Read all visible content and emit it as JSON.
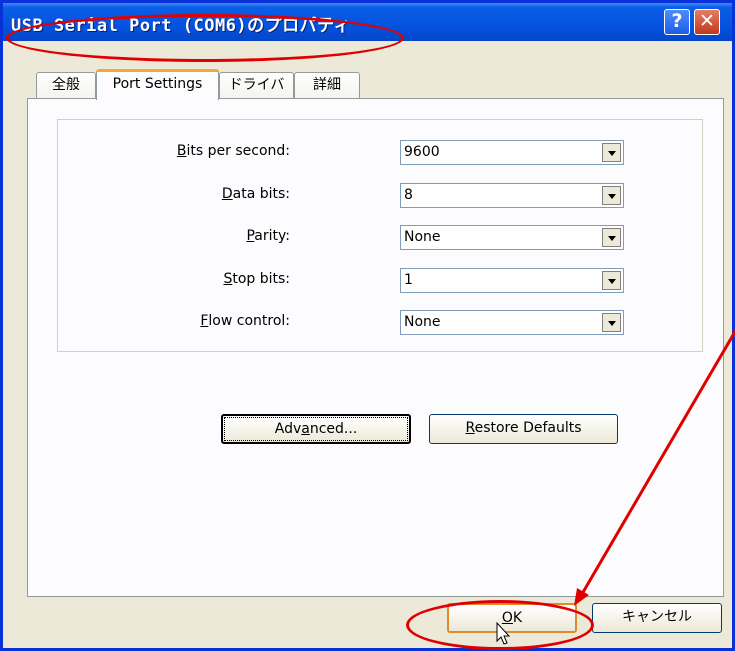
{
  "window": {
    "title": "USB Serial Port (COM6)のプロパティ",
    "help_glyph": "?",
    "close_glyph": "✕"
  },
  "tabs": [
    {
      "label": "全般",
      "active": false
    },
    {
      "label": "Port Settings",
      "active": true
    },
    {
      "label": "ドライバ",
      "active": false
    },
    {
      "label": "詳細",
      "active": false
    }
  ],
  "settings": [
    {
      "label_pre": "",
      "label_key": "B",
      "label_post": "its per second:",
      "value": "9600"
    },
    {
      "label_pre": "",
      "label_key": "D",
      "label_post": "ata bits:",
      "value": "8"
    },
    {
      "label_pre": "",
      "label_key": "P",
      "label_post": "arity:",
      "value": "None"
    },
    {
      "label_pre": "",
      "label_key": "S",
      "label_post": "top bits:",
      "value": "1"
    },
    {
      "label_pre": "",
      "label_key": "F",
      "label_post": "low control:",
      "value": "None"
    }
  ],
  "buttons": {
    "advanced_pre": "Adv",
    "advanced_key": "a",
    "advanced_post": "nced...",
    "restore_key": "R",
    "restore_post": "estore Defaults",
    "ok_key": "O",
    "ok_post": "K",
    "cancel": "キャンセル"
  },
  "annotation": {
    "color": "#e00000"
  }
}
